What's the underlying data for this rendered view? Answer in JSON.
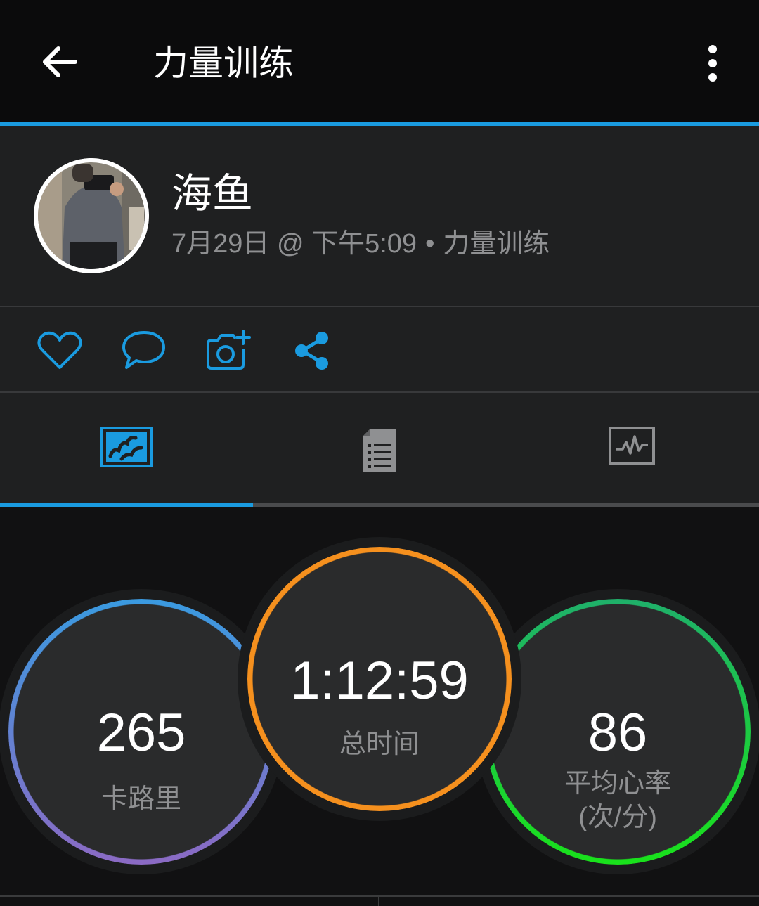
{
  "header": {
    "title": "力量训练"
  },
  "activity": {
    "user_name": "海鱼",
    "date": "7月29日",
    "at": "@",
    "time": "下午5:09",
    "separator": "•",
    "type": "力量训练"
  },
  "actions": {
    "icons": [
      "heart-icon",
      "comment-icon",
      "add-photo-icon",
      "share-icon"
    ]
  },
  "tabs": [
    "map-tab",
    "details-tab",
    "stats-tab"
  ],
  "stats": {
    "calories": {
      "value": "265",
      "label": "卡路里"
    },
    "total_time": {
      "value": "1:12:59",
      "label": "总时间"
    },
    "avg_hr": {
      "value": "86",
      "label_line1": "平均心率",
      "label_line2": "(次/分)"
    }
  },
  "colors": {
    "accent": "#1a9be0",
    "ring_calories_start": "#3a9ae0",
    "ring_calories_end": "#8b6ac4",
    "ring_time": "#f5901e",
    "ring_hr_start": "#1fb06a",
    "ring_hr_end": "#19e21b"
  }
}
